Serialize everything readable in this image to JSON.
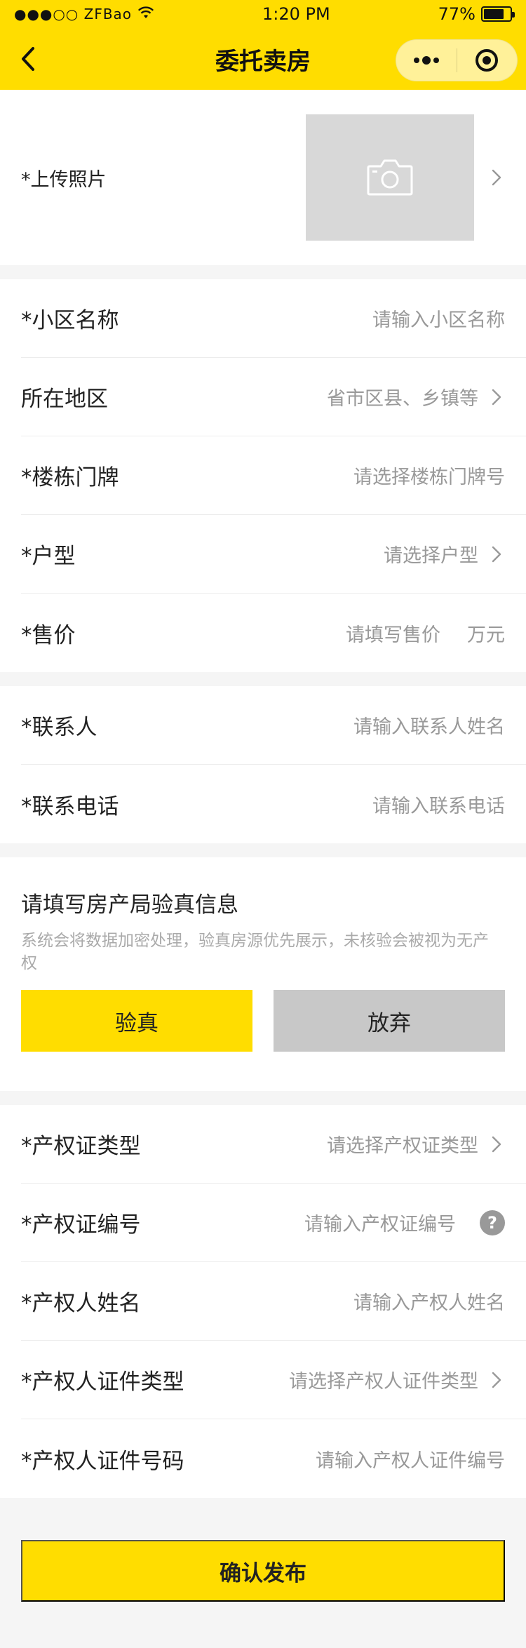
{
  "status_bar": {
    "carrier": "●●●○○ ZFBao",
    "time": "1:20 PM",
    "battery": "77%",
    "battery_level": 0.77
  },
  "nav": {
    "title": "委托卖房",
    "more_icon": "more-dots-icon",
    "close_icon": "target-circle-icon"
  },
  "photo": {
    "label": "*上传照片",
    "icon": "camera-icon"
  },
  "basic_info": [
    {
      "label": "*小区名称",
      "placeholder": "请输入小区名称",
      "chevron": false
    },
    {
      "label": "所在地区",
      "placeholder": "省市区县、乡镇等",
      "chevron": true
    },
    {
      "label": "*楼栋门牌",
      "placeholder": "请选择楼栋门牌号",
      "chevron": false
    },
    {
      "label": "*户型",
      "placeholder": "请选择户型",
      "chevron": true
    },
    {
      "label": "*售价",
      "placeholder": "请填写售价",
      "unit": "万元"
    }
  ],
  "contact": [
    {
      "label": "*联系人",
      "placeholder": "请输入联系人姓名"
    },
    {
      "label": "*联系电话",
      "placeholder": "请输入联系电话"
    }
  ],
  "verify": {
    "title": "请填写房产局验真信息",
    "description": "系统会将数据加密处理，验真房源优先展示，未核验会被视为无产权",
    "confirm_label": "验真",
    "cancel_label": "放弃"
  },
  "property": [
    {
      "label": "*产权证类型",
      "placeholder": "请选择产权证类型",
      "chevron": true
    },
    {
      "label": "*产权证编号",
      "placeholder": "请输入产权证编号",
      "help": "?"
    },
    {
      "label": "*产权人姓名",
      "placeholder": "请输入产权人姓名"
    },
    {
      "label": "*产权人证件类型",
      "placeholder": "请选择产权人证件类型",
      "chevron": true
    },
    {
      "label": "*产权人证件号码",
      "placeholder": "请输入产权人证件编号"
    }
  ],
  "submit": {
    "label": "确认发布"
  },
  "colors": {
    "brand_yellow": "#ffdd00",
    "gray_button": "#c8c8c8",
    "placeholder": "#999999"
  }
}
